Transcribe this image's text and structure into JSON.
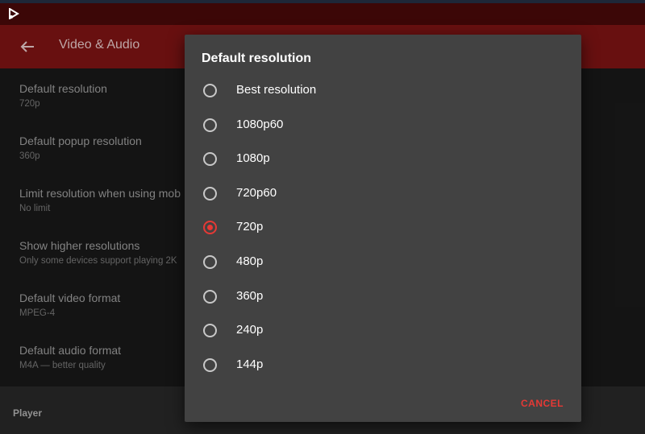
{
  "appbar": {
    "title": "Video & Audio"
  },
  "settings": [
    {
      "title": "Default resolution",
      "summary": "720p"
    },
    {
      "title": "Default popup resolution",
      "summary": "360p"
    },
    {
      "title": "Limit resolution when using mob",
      "summary": "No limit"
    },
    {
      "title": "Show higher resolutions",
      "summary": "Only some devices support playing 2K"
    },
    {
      "title": "Default video format",
      "summary": "MPEG-4"
    },
    {
      "title": "Default audio format",
      "summary": "M4A — better quality"
    }
  ],
  "section": {
    "title": "Player"
  },
  "dialog": {
    "title": "Default resolution",
    "options": [
      {
        "label": "Best resolution"
      },
      {
        "label": "1080p60"
      },
      {
        "label": "1080p"
      },
      {
        "label": "720p60"
      },
      {
        "label": "720p"
      },
      {
        "label": "480p"
      },
      {
        "label": "360p"
      },
      {
        "label": "240p"
      },
      {
        "label": "144p"
      }
    ],
    "selected": "720p",
    "cancel_label": "CANCEL"
  },
  "colors": {
    "accent": "#e53935",
    "appbar": "#6e1111",
    "statusbar": "#3c0707",
    "dialog_bg": "#424242"
  },
  "icons": {
    "status": "play-logo-icon",
    "back": "arrow-back-icon"
  }
}
